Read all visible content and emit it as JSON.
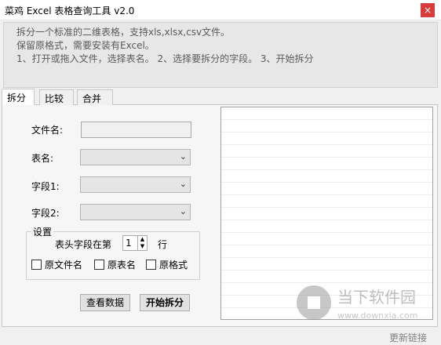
{
  "window": {
    "title": "菜鸡 Excel 表格查询工具 v2.0",
    "close": "×"
  },
  "info": {
    "line1": "拆分一个标准的二维表格，支持xls,xlsx,csv文件。",
    "line2": "保留原格式，需要安装有Excel。",
    "line3": "1、打开或拖入文件，选择表名。  2、选择要拆分的字段。  3、开始拆分"
  },
  "tabs": [
    {
      "label": "拆分",
      "active": true
    },
    {
      "label": "比较",
      "active": false
    },
    {
      "label": "合并",
      "active": false
    }
  ],
  "form": {
    "filename_label": "文件名:",
    "filename_value": "",
    "sheet_label": "表名:",
    "sheet_value": "",
    "field1_label": "字段1:",
    "field1_value": "",
    "field2_label": "字段2:",
    "field2_value": ""
  },
  "settings": {
    "title": "设置",
    "header_row_label": "表头字段在第",
    "header_row_value": "1",
    "header_row_unit": "行",
    "options": [
      {
        "label": "原文件名",
        "checked": false
      },
      {
        "label": "原表名",
        "checked": false
      },
      {
        "label": "原格式",
        "checked": false
      }
    ]
  },
  "buttons": {
    "view_data": "查看数据",
    "start_split": "开始拆分"
  },
  "watermark": {
    "brand": "当下软件园",
    "url": "www.downxia.com"
  },
  "statusbar": {
    "update_link": "更新链接"
  },
  "colors": {
    "close_bg": "#d93a3a",
    "link": "#808080"
  }
}
